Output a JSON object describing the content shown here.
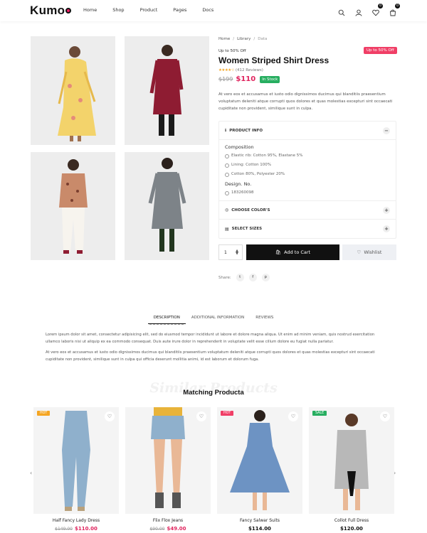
{
  "header": {
    "logo": "Kumo",
    "nav": [
      "Home",
      "Shop",
      "Product",
      "Pages",
      "Docs"
    ],
    "wishlist_count": "0",
    "cart_count": "0"
  },
  "breadcrumb": {
    "home": "Home",
    "mid": "Library",
    "current": "Data"
  },
  "product": {
    "upto": "Up to 50% Off",
    "promo_badge": "Up to 50% Off",
    "title": "Women Striped Shirt Dress",
    "stars": "★★★★☆",
    "reviews": "(412 Reviews)",
    "old_price": "$199",
    "new_price": "$110",
    "stock": "In Stock",
    "description": "At vero eos et accusamus et iusto odio dignissimos ducimus qui blanditiis praesentium voluptatum deleniti atque corrupti quos dolores et quas molestias excepturi sint occaecati cupiditate non provident, similique sunt in culpa."
  },
  "accordion": {
    "info_title": "PRODUCT INFO",
    "composition_label": "Composition",
    "composition": [
      "Elastic rib: Cotton 95%, Elastane 5%",
      "Lining: Cotton 100%",
      "Cotton 80%, Polyester 20%"
    ],
    "design_label": "Design. No.",
    "design_no": "183260098",
    "colors_title": "CHOOSE COLOR'S",
    "sizes_title": "SELECT SIZES"
  },
  "actions": {
    "qty": "1",
    "add_to_cart": "Add to Cart",
    "wishlist": "Wishlist",
    "share_label": "Share:"
  },
  "tabs": [
    "DESCRIPTION",
    "ADDITIONAL INFORMATION",
    "REVIEWS"
  ],
  "description_paragraphs": [
    "Lorem ipsum dolor sit amet, consectetur adipisicing elit, sed do eiusmod tempor incididunt ut labore et dolore magna aliqua. Ut enim ad minim veniam, quis nostrud exercitation ullamco laboris nisi ut aliquip ex ea commodo consequat. Duis aute irure dolor in reprehenderit in voluptate velit esse cillum dolore eu fugiat nulla pariatur.",
    "At vero eos et accusamus et iusto odio dignissimos ducimus qui blanditiis praesentium voluptatum deleniti atque corrupti quos dolores et quas molestias excepturi sint occaecati cupiditate non provident, similique sunt in culpa qui officia deserunt mollitia animi, id est laborum et dolorum fuga."
  ],
  "similar": {
    "bg_title": "Similar Products",
    "title": "Matching Producta",
    "products": [
      {
        "name": "Half Fancy Lady Dress",
        "old": "$149.00",
        "price": "$110.00",
        "tag": "HOT",
        "tag_color": "#f5a623"
      },
      {
        "name": "Flix Flox Jeans",
        "old": "$90.00",
        "price": "$49.00",
        "tag": "",
        "tag_color": ""
      },
      {
        "name": "Fancy Salwar Suits",
        "old": "",
        "price": "$114.00",
        "tag": "HOT",
        "tag_color": "#f03e66"
      },
      {
        "name": "Collot Full Dress",
        "old": "",
        "price": "$120.00",
        "tag": "SALE",
        "tag_color": "#27ae60"
      }
    ]
  },
  "colors": {
    "accent": "#e0245e",
    "stock": "#27ae60",
    "dark": "#111111"
  }
}
